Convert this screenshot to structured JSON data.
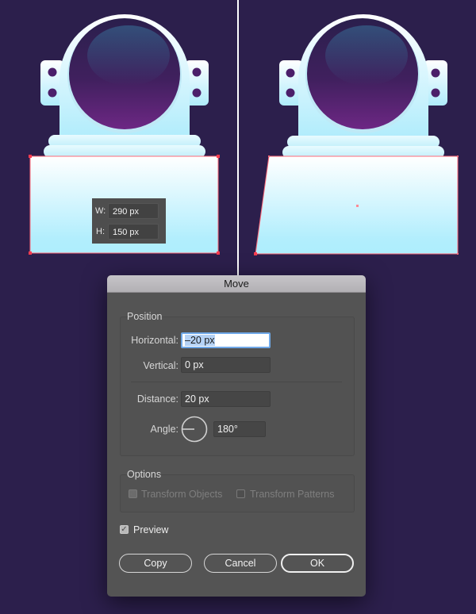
{
  "canvas": {
    "background_color": "#2c1f4c",
    "left_artboard": {
      "description": "astronaut helmet with selected rectangle",
      "dimension_tooltip": {
        "width_label": "W:",
        "width_value": "290 px",
        "height_label": "H:",
        "height_value": "150 px"
      }
    },
    "right_artboard": {
      "description": "astronaut helmet with skewed base shape (preview)"
    },
    "colors": {
      "helmet_white": "#ffffff",
      "helmet_cyan": "#b0ecfc",
      "visor_top": "#2a2050",
      "visor_bottom": "#6a2680",
      "selection": "#ff6b7a"
    }
  },
  "dialog": {
    "title": "Move",
    "position_group": {
      "title": "Position",
      "horizontal_label": "Horizontal:",
      "horizontal_value": "–20 px",
      "vertical_label": "Vertical:",
      "vertical_value": "0 px",
      "distance_label": "Distance:",
      "distance_value": "20 px",
      "angle_label": "Angle:",
      "angle_value": "180°",
      "angle_degrees": 180
    },
    "options_group": {
      "title": "Options",
      "transform_objects_label": "Transform Objects",
      "transform_objects_checked": true,
      "transform_patterns_label": "Transform Patterns",
      "transform_patterns_checked": false
    },
    "preview_label": "Preview",
    "preview_checked": true,
    "buttons": {
      "copy": "Copy",
      "cancel": "Cancel",
      "ok": "OK"
    }
  }
}
